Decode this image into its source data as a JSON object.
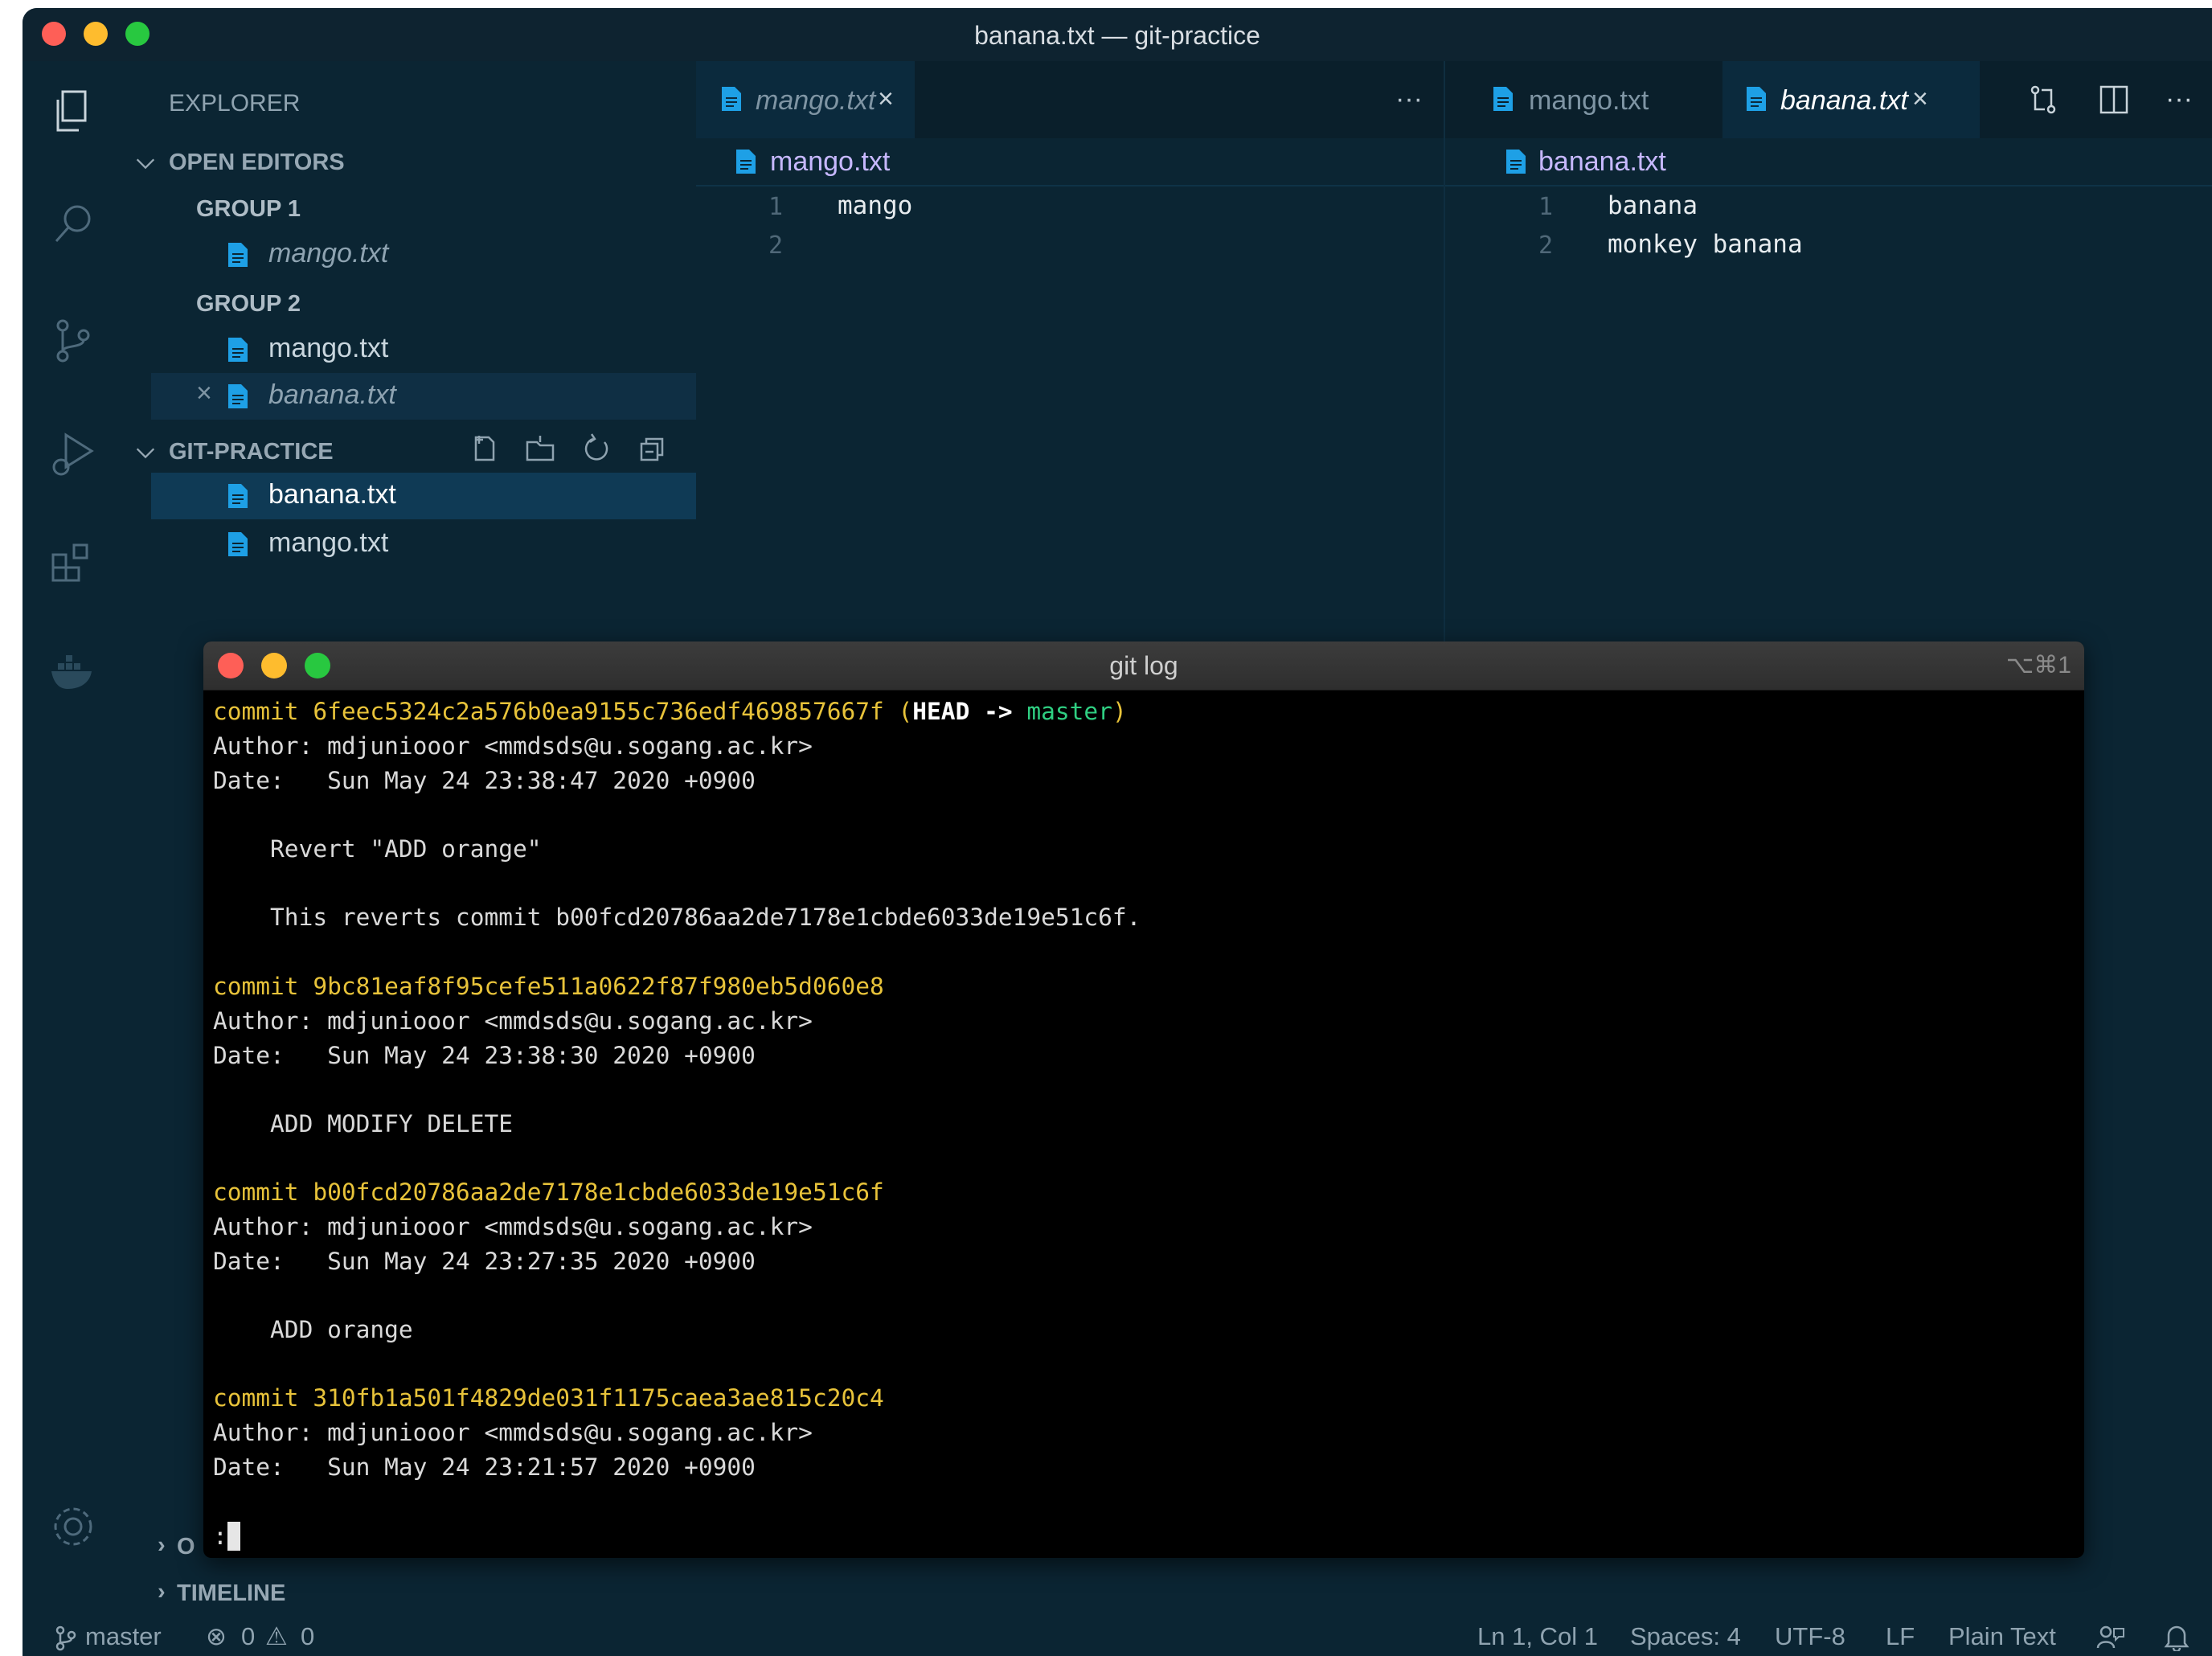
{
  "window": {
    "title": "banana.txt — git-practice"
  },
  "sidebar": {
    "header": "EXPLORER",
    "open_editors": {
      "label": "OPEN EDITORS",
      "groups": [
        {
          "label": "GROUP 1",
          "files": [
            "mango.txt"
          ]
        },
        {
          "label": "GROUP 2",
          "files": [
            "mango.txt",
            "banana.txt"
          ]
        }
      ]
    },
    "workspace": {
      "label": "GIT-PRACTICE",
      "files": [
        "banana.txt",
        "mango.txt"
      ]
    },
    "outline_partial": "O",
    "timeline": "TIMELINE"
  },
  "editor_left": {
    "tab": "mango.txt",
    "breadcrumb": "mango.txt",
    "lines": [
      {
        "no": "1",
        "text": "mango"
      },
      {
        "no": "2",
        "text": ""
      }
    ]
  },
  "editor_right": {
    "tabs": [
      "mango.txt",
      "banana.txt"
    ],
    "breadcrumb": "banana.txt",
    "lines": [
      {
        "no": "1",
        "text": "banana"
      },
      {
        "no": "2",
        "text": "monkey banana"
      }
    ]
  },
  "more_glyph": "···",
  "terminal": {
    "title": "git log",
    "shortcut": "⌥⌘1",
    "head_ref": "HEAD -> ",
    "branch": "master",
    "commits": [
      {
        "hash": "6feec5324c2a576b0ea9155c736edf469857667f",
        "author": "Author: mdjuniooor <mmdsds@u.sogang.ac.kr>",
        "date": "Date:   Sun May 24 23:38:47 2020 +0900",
        "message": "    Revert \"ADD orange\"",
        "extra": "    This reverts commit b00fcd20786aa2de7178e1cbde6033de19e51c6f."
      },
      {
        "hash": "9bc81eaf8f95cefe511a0622f87f980eb5d060e8",
        "author": "Author: mdjuniooor <mmdsds@u.sogang.ac.kr>",
        "date": "Date:   Sun May 24 23:38:30 2020 +0900",
        "message": "    ADD MODIFY DELETE"
      },
      {
        "hash": "b00fcd20786aa2de7178e1cbde6033de19e51c6f",
        "author": "Author: mdjuniooor <mmdsds@u.sogang.ac.kr>",
        "date": "Date:   Sun May 24 23:27:35 2020 +0900",
        "message": "    ADD orange"
      },
      {
        "hash": "310fb1a501f4829de031f1175caea3ae815c20c4",
        "author": "Author: mdjuniooor <mmdsds@u.sogang.ac.kr>",
        "date": "Date:   Sun May 24 23:21:57 2020 +0900"
      }
    ],
    "commit_word": "commit ",
    "prompt": ":"
  },
  "statusbar": {
    "branch": "master",
    "errors": "0",
    "warnings": "0",
    "position": "Ln 1, Col 1",
    "spaces": "Spaces: 4",
    "encoding": "UTF-8",
    "eol": "LF",
    "language": "Plain Text"
  },
  "colors": {
    "accent": "#1ea0e6",
    "commit": "#e8c33a",
    "branch": "#2fcf82"
  }
}
